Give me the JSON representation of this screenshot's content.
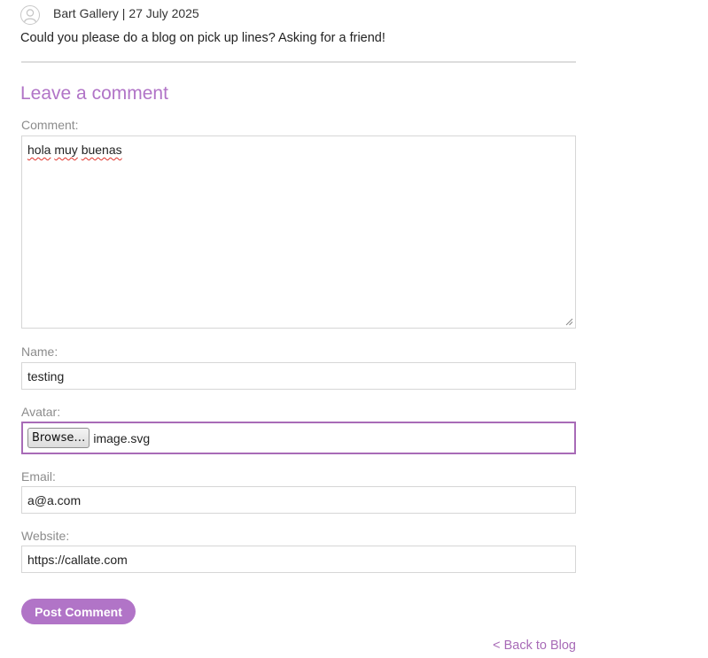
{
  "previous_comment": {
    "author_date": "Bart Gallery | 27 July 2025",
    "text": "Could you please do a blog on pick up lines? Asking for a friend!",
    "avatar_icon": "user-silhouette-icon"
  },
  "form": {
    "heading": "Leave a comment",
    "comment": {
      "label": "Comment:",
      "value_words": [
        "hola",
        "muy",
        "buenas"
      ]
    },
    "name": {
      "label": "Name:",
      "value": "testing"
    },
    "avatar": {
      "label": "Avatar:",
      "button_label": "Browse…",
      "file_name": "image.svg"
    },
    "email": {
      "label": "Email:",
      "value": "a@a.com"
    },
    "website": {
      "label": "Website:",
      "value": "https://callate.com"
    },
    "submit_label": "Post Comment"
  },
  "back_link": "< Back to Blog",
  "colors": {
    "accent": "#b174c7",
    "focus_border": "#a86bb7",
    "label": "#8c8c8c",
    "spellcheck": "#e0342c"
  }
}
